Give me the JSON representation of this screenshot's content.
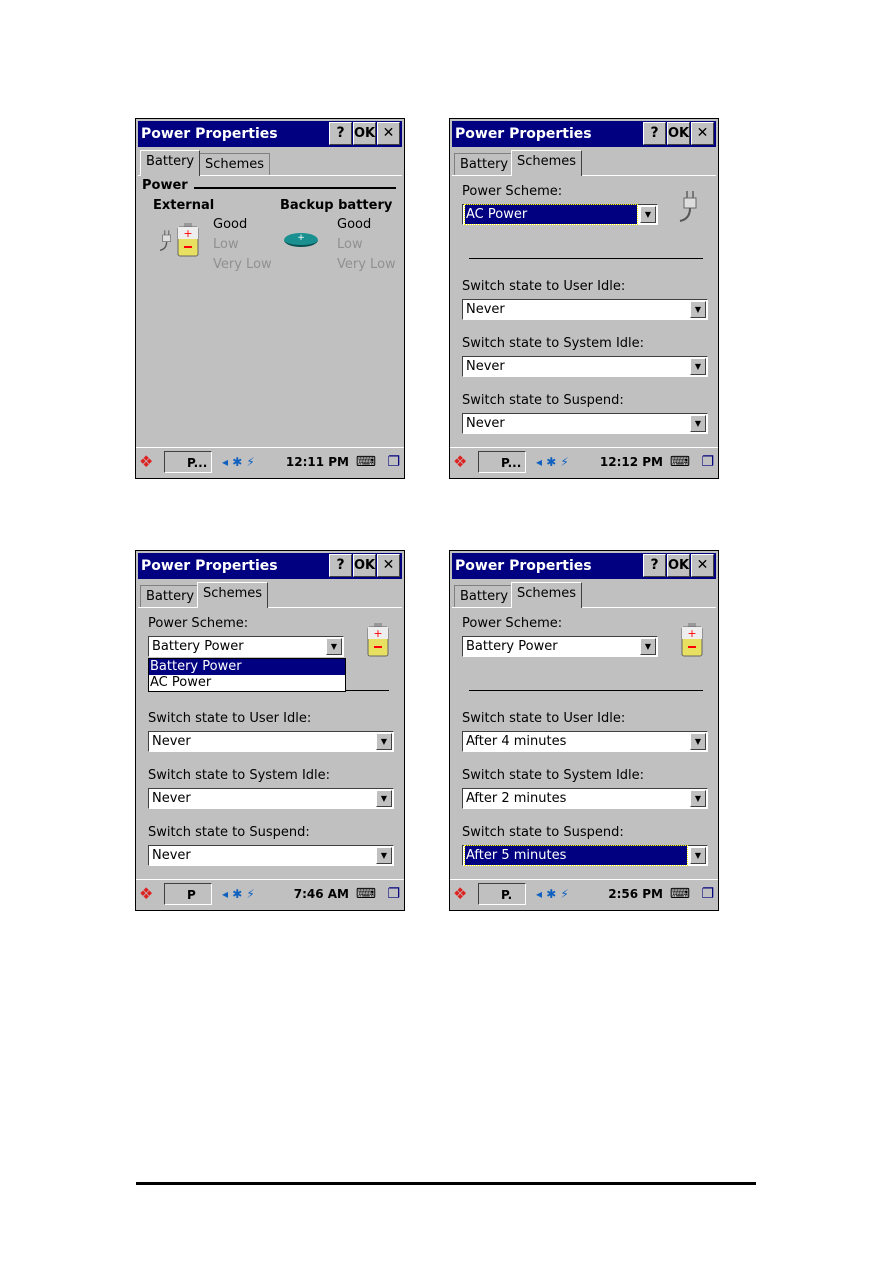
{
  "window_title": "Power Properties",
  "buttons": {
    "help": "?",
    "ok": "OK",
    "close": "✕"
  },
  "tabs": [
    "Battery",
    "Schemes"
  ],
  "screens": [
    {
      "type": "battery",
      "clock": "12:11 PM",
      "task": "P...",
      "power_label": "Power",
      "external": "External",
      "backup": "Backup battery",
      "external_levels": [
        "Good",
        "Low",
        "Very Low"
      ],
      "backup_levels": [
        "Good",
        "Low",
        "Very Low"
      ],
      "active_level": "Good"
    },
    {
      "type": "schemes",
      "clock": "12:12 PM",
      "task": "P...",
      "scheme_icon": "plug-icon",
      "scheme_label": "Power Scheme:",
      "scheme_value": "AC Power",
      "scheme_selected": true,
      "settings": [
        {
          "label": "Switch state to User Idle:",
          "value": "Never"
        },
        {
          "label": "Switch state to System Idle:",
          "value": "Never"
        },
        {
          "label": "Switch state to Suspend:",
          "value": "Never"
        }
      ]
    },
    {
      "type": "schemes",
      "clock": "7:46 AM",
      "task": "P",
      "scheme_icon": "battery-icon",
      "scheme_label": "Power Scheme:",
      "scheme_value": "Battery Power",
      "dropdown_options": [
        "Battery Power",
        "AC Power"
      ],
      "dropdown_highlighted": "Battery Power",
      "settings": [
        {
          "label": "Switch state to User Idle:",
          "value": "Never"
        },
        {
          "label": "Switch state to System Idle:",
          "value": "Never"
        },
        {
          "label": "Switch state to Suspend:",
          "value": "Never"
        }
      ]
    },
    {
      "type": "schemes",
      "clock": "2:56 PM",
      "task": "P.",
      "scheme_icon": "battery-icon",
      "scheme_label": "Power Scheme:",
      "scheme_value": "Battery Power",
      "settings": [
        {
          "label": "Switch state to User Idle:",
          "value": "After 4 minutes"
        },
        {
          "label": "Switch state to System Idle:",
          "value": "After 2 minutes"
        },
        {
          "label": "Switch state to Suspend:",
          "value": "After 5 minutes",
          "selected": true
        }
      ]
    }
  ],
  "colors": {
    "titlebar": "#000080",
    "face": "#c0c0c0",
    "selection": "#000080",
    "disabled": "#909090"
  }
}
